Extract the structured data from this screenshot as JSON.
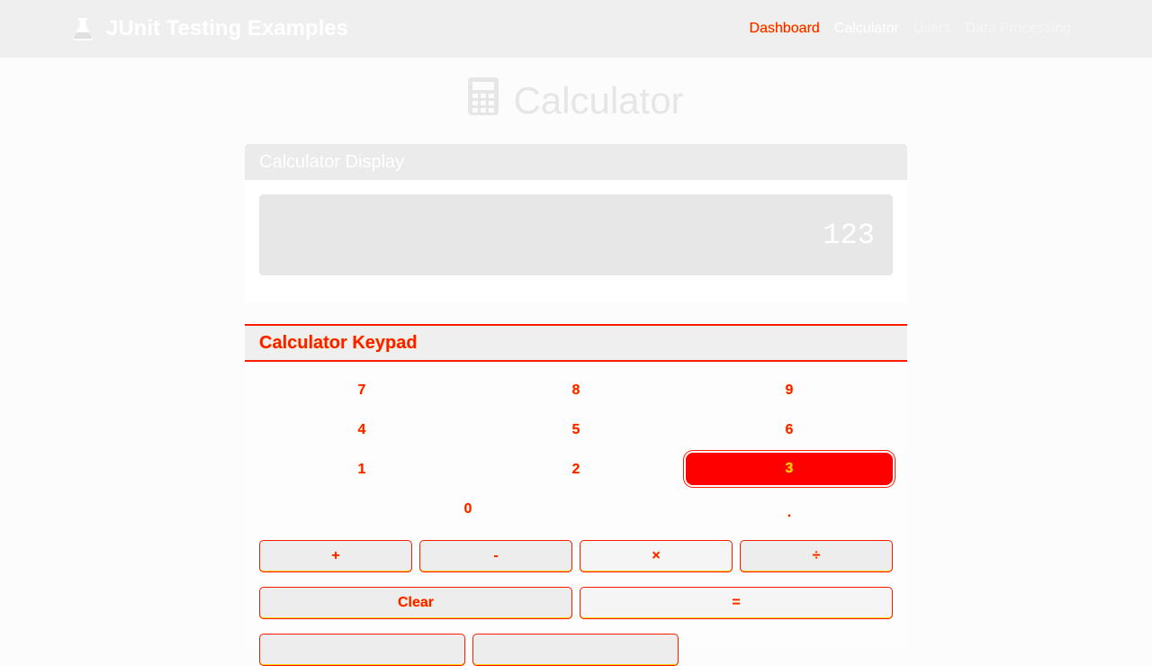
{
  "navbar": {
    "brand": "JUnit Testing Examples",
    "brand_icon": "flask-icon",
    "links": [
      "Dashboard",
      "Calculator",
      "Users",
      "Data Processing"
    ]
  },
  "page": {
    "title": "Calculator",
    "title_icon": "calculator-icon"
  },
  "display_card": {
    "header": "Calculator Display",
    "value": "123"
  },
  "keypad_card": {
    "header": "Calculator Keypad",
    "digits": [
      "7",
      "8",
      "9",
      "4",
      "5",
      "6",
      "1",
      "2",
      "3",
      "0",
      "."
    ],
    "operators": [
      "+",
      "-",
      "×",
      "÷"
    ],
    "clear_label": "Clear",
    "equals_label": "="
  },
  "colors": {
    "accent": "#ff1a00",
    "highlight": "#ff0000"
  }
}
